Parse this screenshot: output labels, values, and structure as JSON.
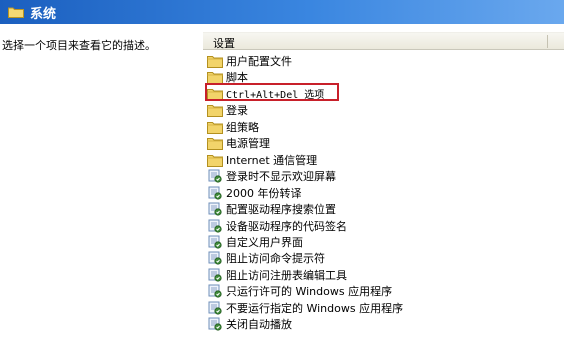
{
  "window": {
    "title": "系统"
  },
  "description_pane": {
    "text": "选择一个项目来查看它的描述。"
  },
  "list": {
    "column_header": "设置",
    "items": [
      {
        "label": "用户配置文件",
        "type": "folder"
      },
      {
        "label": "脚本",
        "type": "folder"
      },
      {
        "label": "Ctrl+Alt+Del 选项",
        "type": "folder",
        "mono": true
      },
      {
        "label": "登录",
        "type": "folder"
      },
      {
        "label": "组策略",
        "type": "folder"
      },
      {
        "label": "电源管理",
        "type": "folder"
      },
      {
        "label": "Internet 通信管理",
        "type": "folder"
      },
      {
        "label": "登录时不显示欢迎屏幕",
        "type": "setting"
      },
      {
        "label": "2000 年份转译",
        "type": "setting"
      },
      {
        "label": "配置驱动程序搜索位置",
        "type": "setting"
      },
      {
        "label": "设备驱动程序的代码签名",
        "type": "setting"
      },
      {
        "label": "自定义用户界面",
        "type": "setting"
      },
      {
        "label": "阻止访问命令提示符",
        "type": "setting"
      },
      {
        "label": "阻止访问注册表编辑工具",
        "type": "setting"
      },
      {
        "label": "只运行许可的 Windows 应用程序",
        "type": "setting"
      },
      {
        "label": "不要运行指定的 Windows 应用程序",
        "type": "setting"
      },
      {
        "label": "关闭自动播放",
        "type": "setting"
      }
    ]
  },
  "colors": {
    "titlebar": "#2a74d6",
    "highlight": "#c8202a",
    "folder": "#f2d46a"
  },
  "icons": {
    "folder": "folder-icon",
    "setting": "policy-setting-icon"
  }
}
